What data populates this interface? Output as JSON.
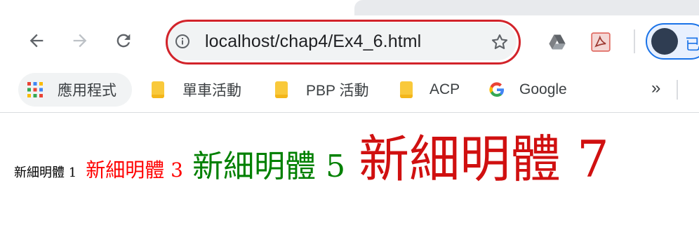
{
  "browser": {
    "address_bar": {
      "url": "localhost/chap4/Ex4_6.html"
    },
    "profile_label": "已"
  },
  "bookmarks": {
    "apps_label": "應用程式",
    "items": [
      {
        "label": "單車活動",
        "icon": "folder-icon"
      },
      {
        "label": "PBP 活動",
        "icon": "folder-icon"
      },
      {
        "label": "ACP",
        "icon": "folder-icon"
      },
      {
        "label": "Google",
        "icon": "google-icon"
      }
    ],
    "overflow_label": "»"
  },
  "page": {
    "samples": [
      {
        "text": "新細明體 1",
        "size": 1,
        "color": "#000000"
      },
      {
        "text": "新細明體 3",
        "size": 3,
        "color": "#ff0000"
      },
      {
        "text": "新細明體 5",
        "size": 5,
        "color": "#008000"
      },
      {
        "text": "新細明體 7",
        "size": 7,
        "color": "#d01010"
      }
    ]
  },
  "colors": {
    "annotation_ring": "#d2232a",
    "google_blue": "#4285f4",
    "google_red": "#ea4335",
    "google_yellow": "#fbbc05",
    "google_green": "#34a853"
  }
}
